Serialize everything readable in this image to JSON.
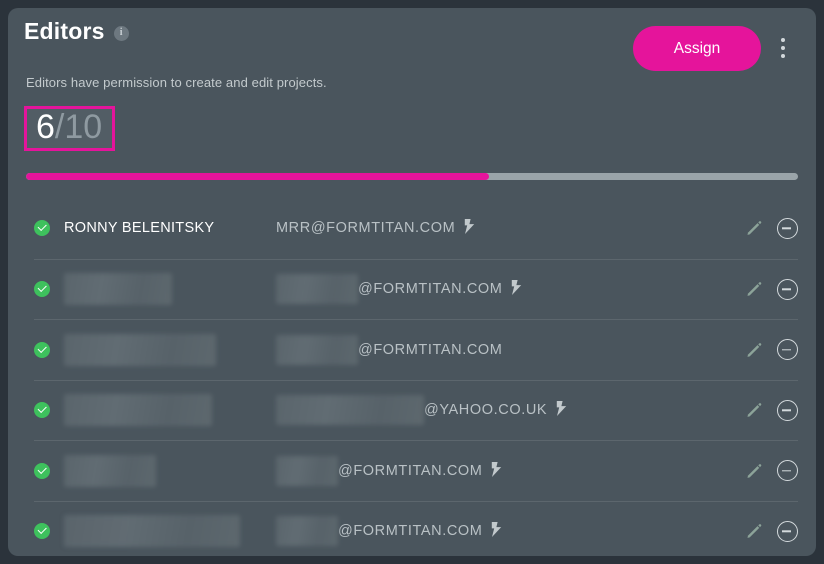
{
  "card": {
    "title": "Editors",
    "info_icon": "info-icon",
    "subtitle": "Editors have permission to create and edit projects.",
    "assign_label": "Assign",
    "menu_icon": "kebab-menu-icon"
  },
  "counter": {
    "current": "6",
    "total": "/10",
    "used": 6,
    "limit": 10,
    "percent": 60,
    "highlight_color": "#e5149b"
  },
  "progress": {
    "fill_color": "#e5149b",
    "track_color": "#9aa4a9",
    "percent": 60
  },
  "colors": {
    "page_background": "#2b333b",
    "card_background": "#4a555d",
    "accent": "#e5149b",
    "status_green": "#3ec15d",
    "separator": "#5c666d",
    "email_text": "#b9c1c5"
  },
  "icons": {
    "status": "check-circle-icon",
    "bolt": "lightning-bolt-icon",
    "edit": "pencil-icon",
    "remove": "minus-circle-icon"
  },
  "rows": [
    {
      "status": "active",
      "name": "RONNY BELENITSKY",
      "name_redacted": false,
      "name_redact_width": 0,
      "email": "MRR@FORMTITAN.COM",
      "email_redact_width": 0,
      "has_bolt": true
    },
    {
      "status": "active",
      "name": "",
      "name_redacted": true,
      "name_redact_width": 108,
      "email": "@FORMTITAN.COM",
      "email_redact_width": 82,
      "has_bolt": true
    },
    {
      "status": "active",
      "name": "",
      "name_redacted": true,
      "name_redact_width": 152,
      "email": "@FORMTITAN.COM",
      "email_redact_width": 82,
      "has_bolt": false
    },
    {
      "status": "active",
      "name": "",
      "name_redacted": true,
      "name_redact_width": 148,
      "email": "@YAHOO.CO.UK",
      "email_redact_width": 148,
      "has_bolt": true
    },
    {
      "status": "active",
      "name": "",
      "name_redacted": true,
      "name_redact_width": 92,
      "email": "@FORMTITAN.COM",
      "email_redact_width": 62,
      "has_bolt": true
    },
    {
      "status": "active",
      "name": "",
      "name_redacted": true,
      "name_redact_width": 176,
      "email": "@FORMTITAN.COM",
      "email_redact_width": 62,
      "has_bolt": true
    }
  ]
}
